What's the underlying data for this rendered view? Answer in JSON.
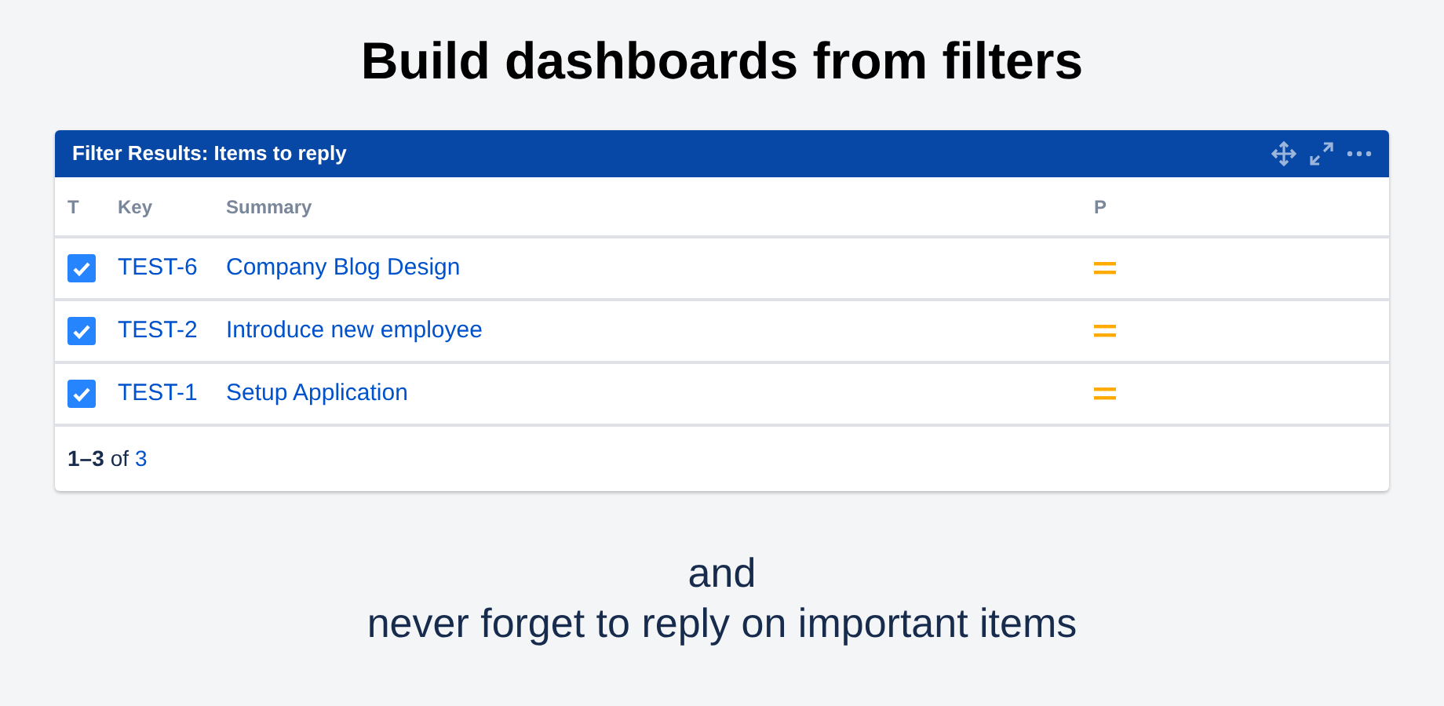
{
  "heading": "Build dashboards from filters",
  "gadget": {
    "title": "Filter Results: Items to reply",
    "columns": [
      "T",
      "Key",
      "Summary",
      "P"
    ],
    "rows": [
      {
        "checked": true,
        "key": "TEST-6",
        "summary": "Company Blog Design"
      },
      {
        "checked": true,
        "key": "TEST-2",
        "summary": "Introduce new employee"
      },
      {
        "checked": true,
        "key": "TEST-1",
        "summary": "Setup Application"
      }
    ],
    "pagination": {
      "range": "1–3",
      "of": "of",
      "total": "3"
    }
  },
  "caption": [
    "and",
    "never forget to reply on important items"
  ]
}
